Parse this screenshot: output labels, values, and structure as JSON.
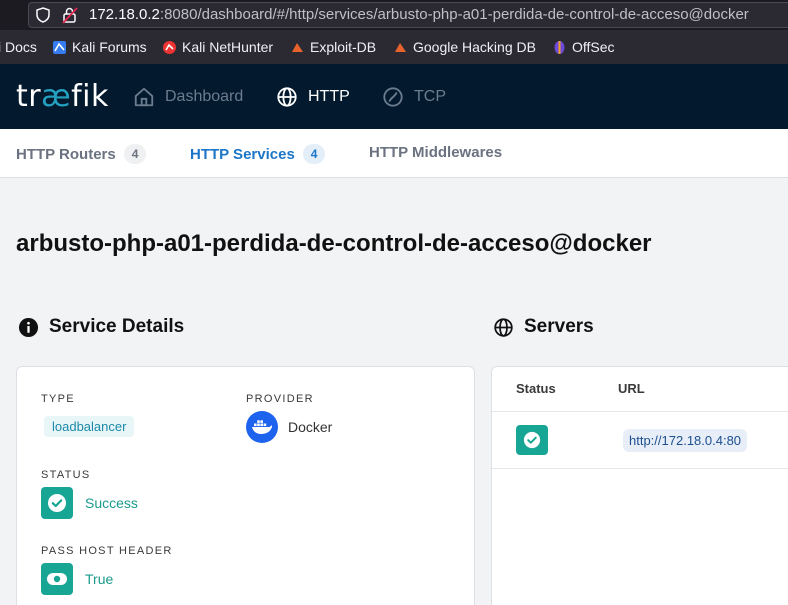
{
  "browser": {
    "url_host": "172.18.0.2",
    "url_rest": ":8080/dashboard/#/http/services/arbusto-php-a01-perdida-de-control-de-acceso@docker",
    "bookmarks": [
      {
        "label": "i Docs"
      },
      {
        "label": "Kali Forums"
      },
      {
        "label": "Kali NetHunter"
      },
      {
        "label": "Exploit-DB"
      },
      {
        "label": "Google Hacking DB"
      },
      {
        "label": "OffSec"
      }
    ]
  },
  "nav": {
    "logo_tr": "tr",
    "logo_ae": "æ",
    "logo_fik": "fik",
    "dashboard": "Dashboard",
    "http": "HTTP",
    "tcp": "TCP"
  },
  "tabs": {
    "routers": {
      "label": "HTTP Routers",
      "count": "4"
    },
    "services": {
      "label": "HTTP Services",
      "count": "4"
    },
    "middlewares": {
      "label": "HTTP Middlewares"
    }
  },
  "page": {
    "title": "arbusto-php-a01-perdida-de-control-de-acceso@docker"
  },
  "details": {
    "heading": "Service Details",
    "type_label": "TYPE",
    "type_value": "loadbalancer",
    "provider_label": "PROVIDER",
    "provider_value": "Docker",
    "status_label": "STATUS",
    "status_value": "Success",
    "pass_host_label": "PASS HOST HEADER",
    "pass_host_value": "True"
  },
  "servers": {
    "heading": "Servers",
    "col_status": "Status",
    "col_url": "URL",
    "rows": [
      {
        "url": "http://172.18.0.4:80"
      }
    ]
  },
  "colors": {
    "nav_bg": "#03192d",
    "accent": "#1b76c8",
    "success": "#17a594"
  }
}
